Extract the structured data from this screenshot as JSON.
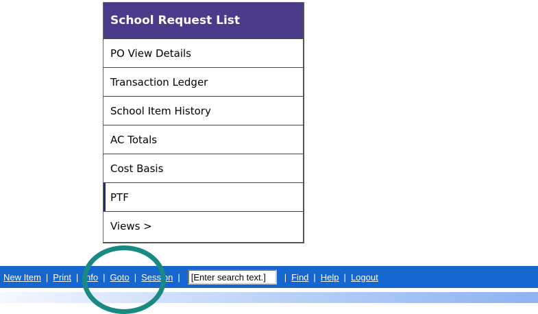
{
  "menu": {
    "header": "School Request List",
    "items": [
      {
        "label": "PO View Details"
      },
      {
        "label": "Transaction Ledger"
      },
      {
        "label": "School Item History"
      },
      {
        "label": "AC Totals"
      },
      {
        "label": "Cost Basis"
      },
      {
        "label": "PTF"
      },
      {
        "label": "Views >"
      }
    ]
  },
  "toolbar": {
    "new_item": "New Item",
    "print": "Print",
    "info": "Info",
    "goto": "Goto",
    "session": "Session",
    "search_value": "[Enter search text.]",
    "find": "Find",
    "help": "Help",
    "logout": "Logout",
    "separator": "|"
  },
  "colors": {
    "menu_header": "#4b3a8a",
    "toolbar": "#1566cf",
    "highlight_circle": "#188a82"
  }
}
